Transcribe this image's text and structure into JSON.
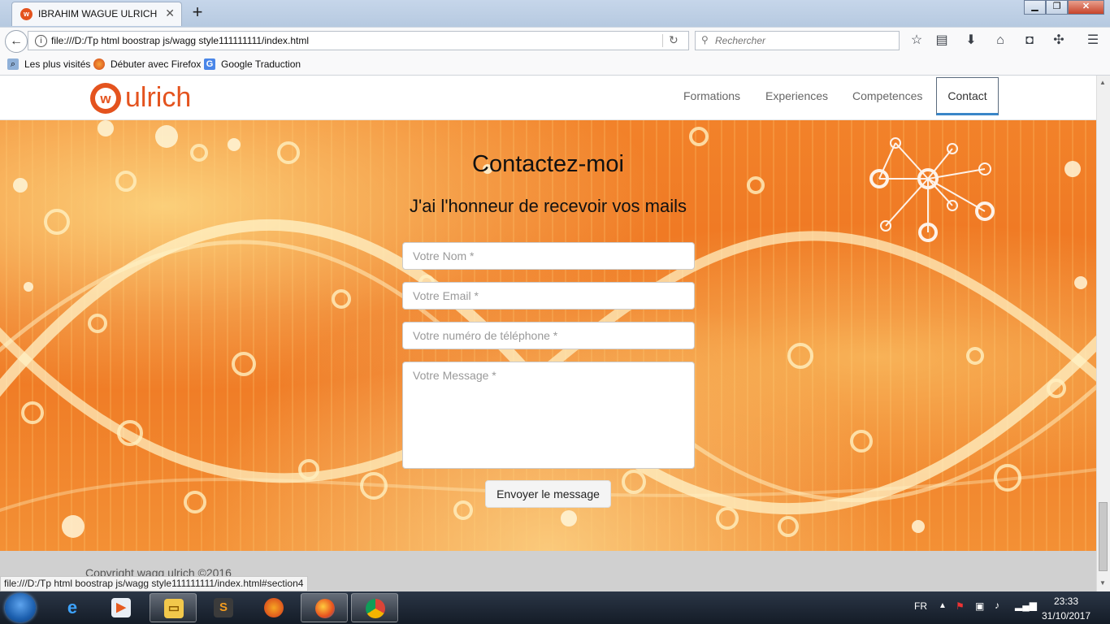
{
  "browser": {
    "tab_title": "IBRAHIM WAGUE ULRICH",
    "tab_favicon": "w",
    "new_tab_symbol": "+",
    "url": "file:///D:/Tp html boostrap js/wagg style111111111/index.html",
    "search_placeholder": "Rechercher",
    "bookmarks": [
      "Les plus visités",
      "Débuter avec Firefox",
      "Google Traduction"
    ],
    "toolbar_icons": [
      "star-icon",
      "reading-list-icon",
      "download-icon",
      "home-icon",
      "pocket-icon",
      "extension-icon",
      "menu-icon"
    ]
  },
  "site": {
    "logo_text": "ulrich",
    "logo_mark": "w",
    "nav": [
      "Formations",
      "Experiences",
      "Competences",
      "Contact"
    ],
    "active_nav": "Contact"
  },
  "contact": {
    "title": "Contactez-moi",
    "subtitle": "J'ai l'honneur de recevoir vos mails",
    "name_placeholder": "Votre Nom *",
    "email_placeholder": "Votre Email *",
    "phone_placeholder": "Votre numéro de téléphone *",
    "message_placeholder": "Votre Message *",
    "submit_label": "Envoyer le message"
  },
  "footer": {
    "copyright": "Copyright wagg ulrich ©2016"
  },
  "status_bar": {
    "url": "file:///D:/Tp html boostrap js/wagg style111111111/index.html#section4"
  },
  "taskbar": {
    "apps": [
      "internet-explorer",
      "media-player",
      "file-explorer",
      "sublime-text",
      "app-icon",
      "firefox",
      "chrome"
    ],
    "language": "FR",
    "time": "23:33",
    "date": "31/10/2017"
  },
  "colors": {
    "accent_orange": "#ee7420",
    "active_nav_border": "#3a86c8",
    "logo_orange": "#e4531e"
  }
}
